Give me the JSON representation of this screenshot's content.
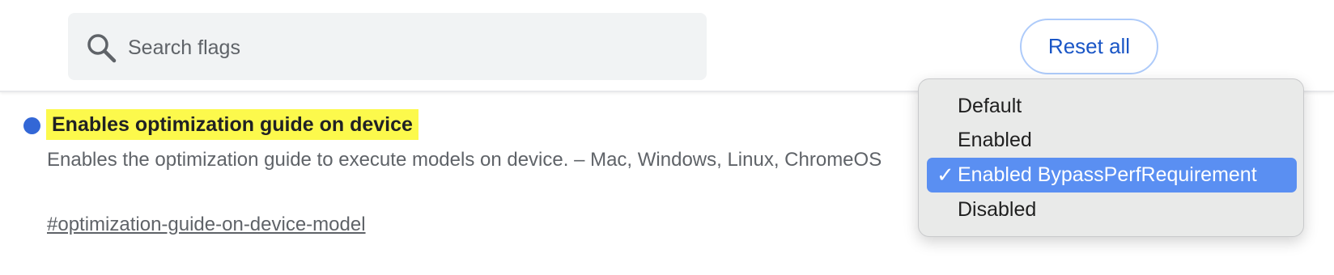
{
  "search": {
    "placeholder": "Search flags",
    "icon": "search-icon"
  },
  "header": {
    "reset_label": "Reset all"
  },
  "flag": {
    "title": "Enables optimization guide on device",
    "description": "Enables the optimization guide to execute models on device. – Mac, Windows, Linux, ChromeOS",
    "link": "#optimization-guide-on-device-model",
    "status_color": "#3367d6",
    "highlight_color": "#fcf94c"
  },
  "dropdown": {
    "selected": "Enabled BypassPerfRequirement",
    "check_mark": "✓",
    "options": [
      {
        "label": "Default"
      },
      {
        "label": "Enabled"
      },
      {
        "label": "Enabled BypassPerfRequirement"
      },
      {
        "label": "Disabled"
      }
    ],
    "selected_color": "#5a8ff2"
  }
}
